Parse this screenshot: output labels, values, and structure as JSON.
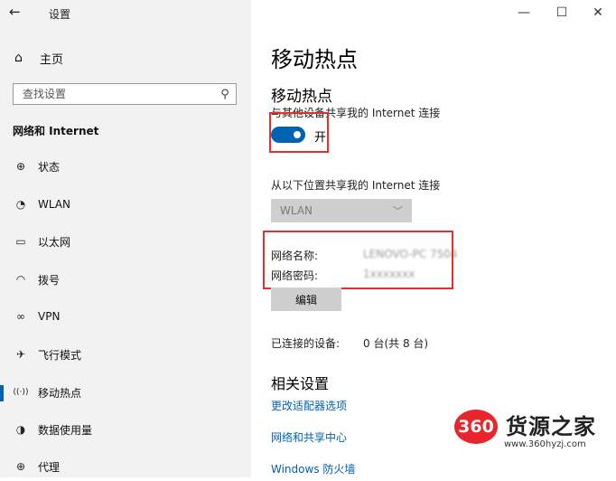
{
  "window": {
    "back_glyph": "←",
    "title": "设置",
    "minimize_glyph": "—",
    "maximize_glyph": "☐",
    "close_glyph": "✕"
  },
  "sidebar": {
    "home_label": "主页",
    "search_placeholder": "查找设置",
    "section_title": "网络和 Internet",
    "items": [
      {
        "label": "状态",
        "icon": "globe-icon",
        "glyph": "⊕"
      },
      {
        "label": "WLAN",
        "icon": "wifi-icon",
        "glyph": "◔"
      },
      {
        "label": "以太网",
        "icon": "ethernet-icon",
        "glyph": "▭"
      },
      {
        "label": "拨号",
        "icon": "dialup-icon",
        "glyph": "◠"
      },
      {
        "label": "VPN",
        "icon": "vpn-icon",
        "glyph": "∞"
      },
      {
        "label": "飞行模式",
        "icon": "airplane-icon",
        "glyph": "✈"
      },
      {
        "label": "移动热点",
        "icon": "hotspot-icon",
        "glyph": "((·))"
      },
      {
        "label": "数据使用量",
        "icon": "data-usage-icon",
        "glyph": "◑"
      },
      {
        "label": "代理",
        "icon": "proxy-icon",
        "glyph": "⊕"
      }
    ],
    "active_index": 6
  },
  "main": {
    "page_title": "移动热点",
    "section_title": "移动热点",
    "share_desc": "与其他设备共享我的 Internet 连接",
    "toggle_state": "开",
    "share_from_label": "从以下位置共享我的 Internet 连接",
    "share_from_value": "WLAN",
    "network_name_label": "网络名称:",
    "network_name_value": "LENOVO-PC 7504",
    "network_password_label": "网络密码:",
    "network_password_value": "1xxxxxxx",
    "edit_button": "编辑",
    "connected_label": "已连接的设备:",
    "connected_value": "0 台(共 8 台)",
    "related_title": "相关设置",
    "related_links": [
      "更改适配器选项",
      "网络和共享中心",
      "Windows 防火墙"
    ]
  },
  "watermark": {
    "badge": "360",
    "text": "货源之家",
    "url": "www.360hyzj.com"
  },
  "colors": {
    "accent": "#0063b1",
    "highlight_box": "#e03030",
    "sidebar_bg": "#f2f2f2"
  }
}
